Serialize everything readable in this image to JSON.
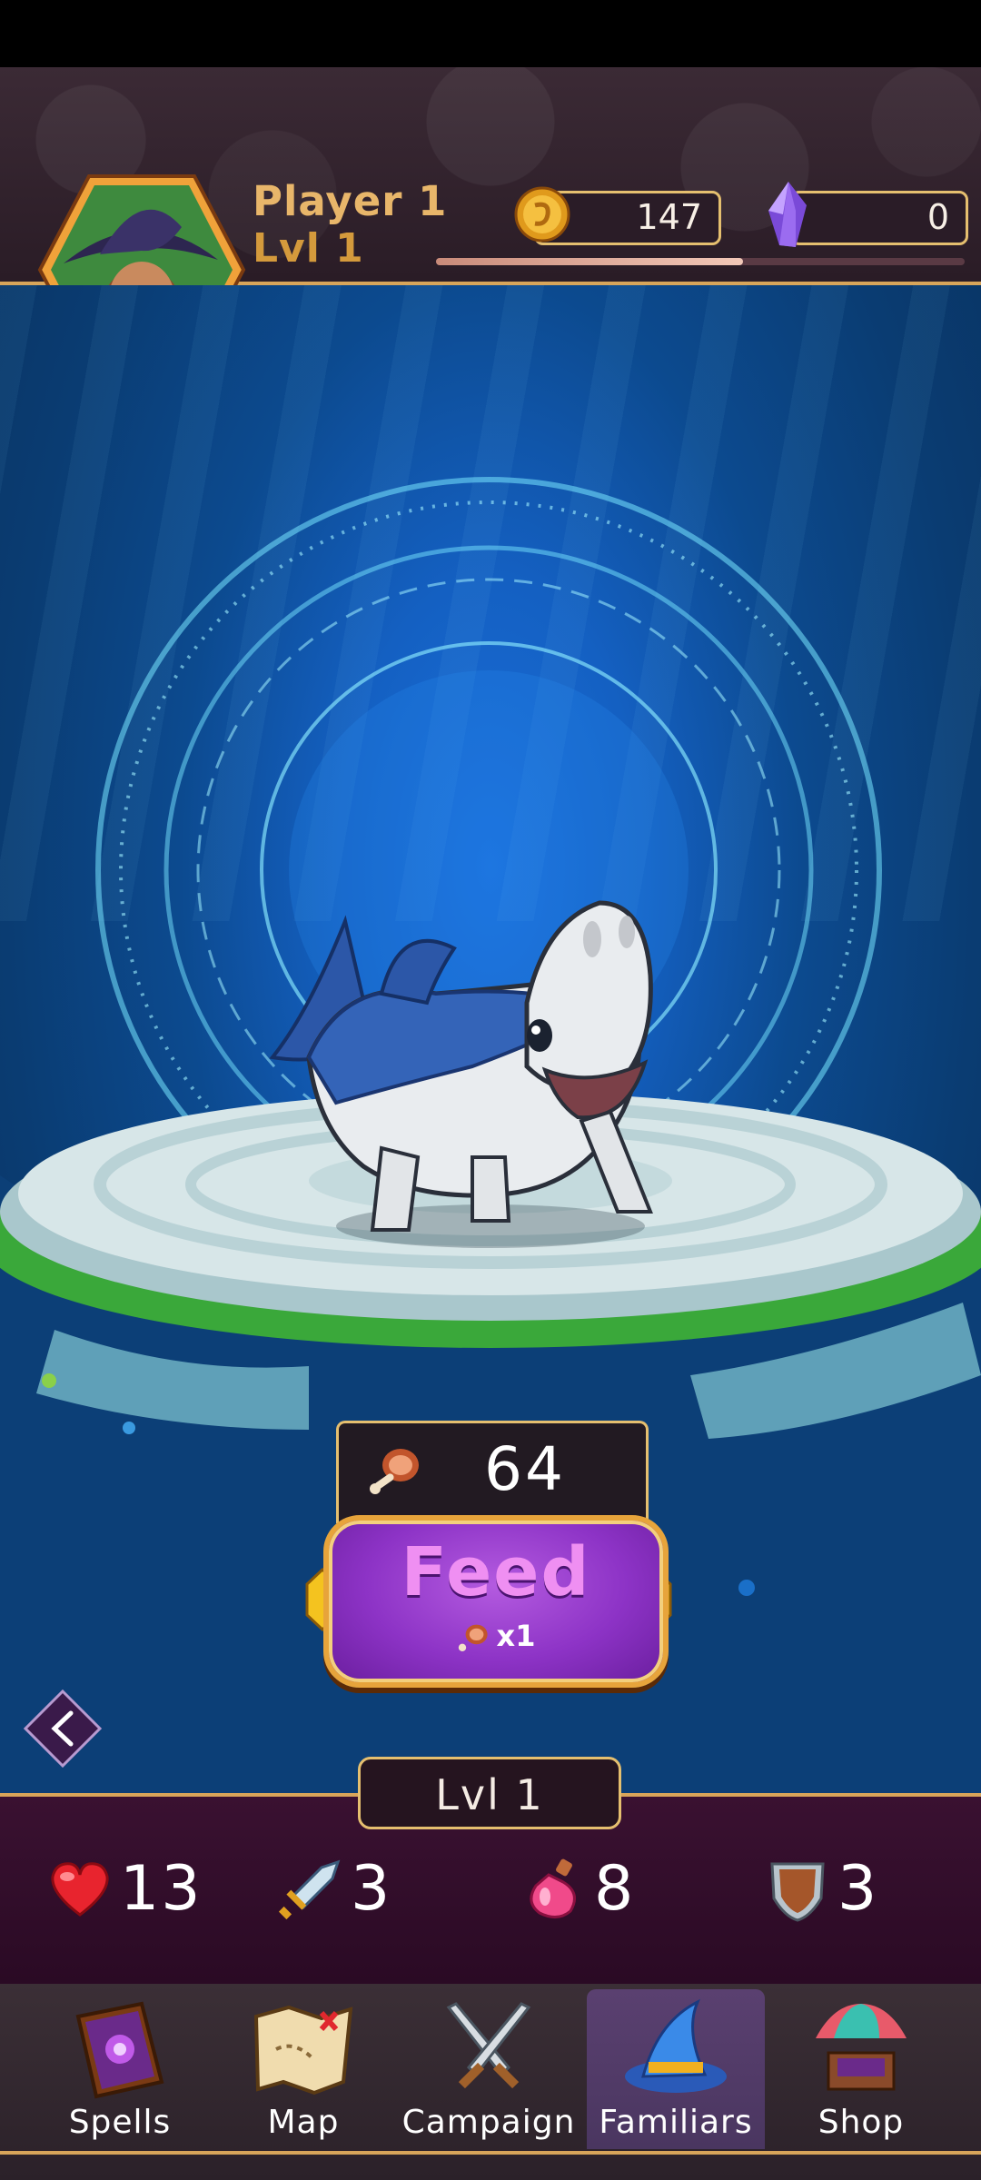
{
  "player": {
    "name": "Player 1",
    "level": "Lvl 1",
    "xp_progress": 0.58
  },
  "currency": {
    "coins": "147",
    "gems": "0"
  },
  "familiar": {
    "name": "shark familiar",
    "food_count": "64",
    "level": "Lvl 1"
  },
  "feed_button": {
    "label": "Feed",
    "cost": "x1"
  },
  "stats": [
    {
      "icon": "heart-icon",
      "value": "13"
    },
    {
      "icon": "sword-icon",
      "value": "3"
    },
    {
      "icon": "potion-icon",
      "value": "8"
    },
    {
      "icon": "shield-icon",
      "value": "3"
    }
  ],
  "nav": {
    "spells": "Spells",
    "map": "Map",
    "campaign": "Campaign",
    "familiars": "Familiars",
    "shop": "Shop",
    "active": "familiars"
  },
  "colors": {
    "gold": "#e5bf6f",
    "feed_purple": "#8d33c6",
    "scene_blue": "#1460c2"
  }
}
